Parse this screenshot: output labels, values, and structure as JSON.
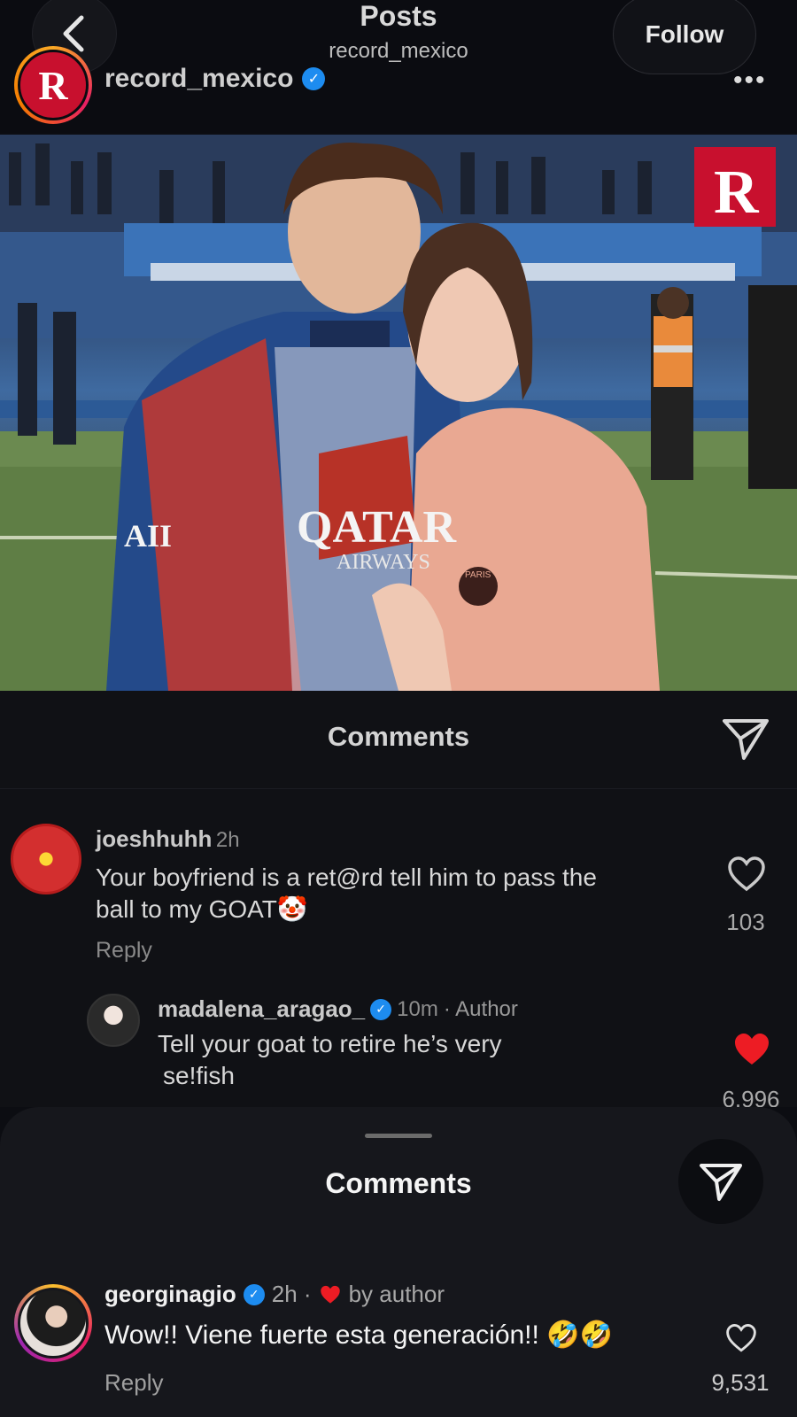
{
  "header": {
    "title": "Posts",
    "subtitle": "record_mexico",
    "follow_label": "Follow",
    "post_username": "record_mexico",
    "avatar_letter": "R",
    "more_label": "•••"
  },
  "photo": {
    "logo_letter": "R",
    "jersey_sponsor": "QATAR",
    "jersey_sponsor_2": "AIRWAYS",
    "sleeve_text": "AII",
    "badge_text": "PARIS"
  },
  "comments_panel": {
    "title": "Comments",
    "comment": {
      "user": "joeshhuhh",
      "time": "2h",
      "line1": "Your boyfriend is a ret@rd tell him to pass the",
      "line2": "ball to my GOAT",
      "emoji": "🤡",
      "reply_label": "Reply",
      "likes": "103"
    },
    "reply": {
      "user": "madalena_aragao_",
      "time": "10m",
      "author_tag": "· Author",
      "line1": "Tell your goat to retire he’s very",
      "line2": "se!fish",
      "likes": "6.996",
      "liked": true
    }
  },
  "sheet": {
    "title": "Comments",
    "comment": {
      "user": "georginagio",
      "time": "2h ·",
      "by_author": "by author",
      "text": "Wow!! Viene fuerte esta generación!!",
      "emoji": "🤣🤣",
      "reply_label": "Reply",
      "likes": "9,531"
    }
  },
  "colors": {
    "background": "#0c0d12",
    "sheet": "#16171c",
    "verified_blue": "#1d8cf0",
    "like_red": "#ed1c24",
    "record_red": "#c8102e"
  },
  "icons": [
    "chevron-left-icon",
    "verified-icon",
    "more-icon",
    "send-icon",
    "heart-icon",
    "heart-filled-icon"
  ]
}
